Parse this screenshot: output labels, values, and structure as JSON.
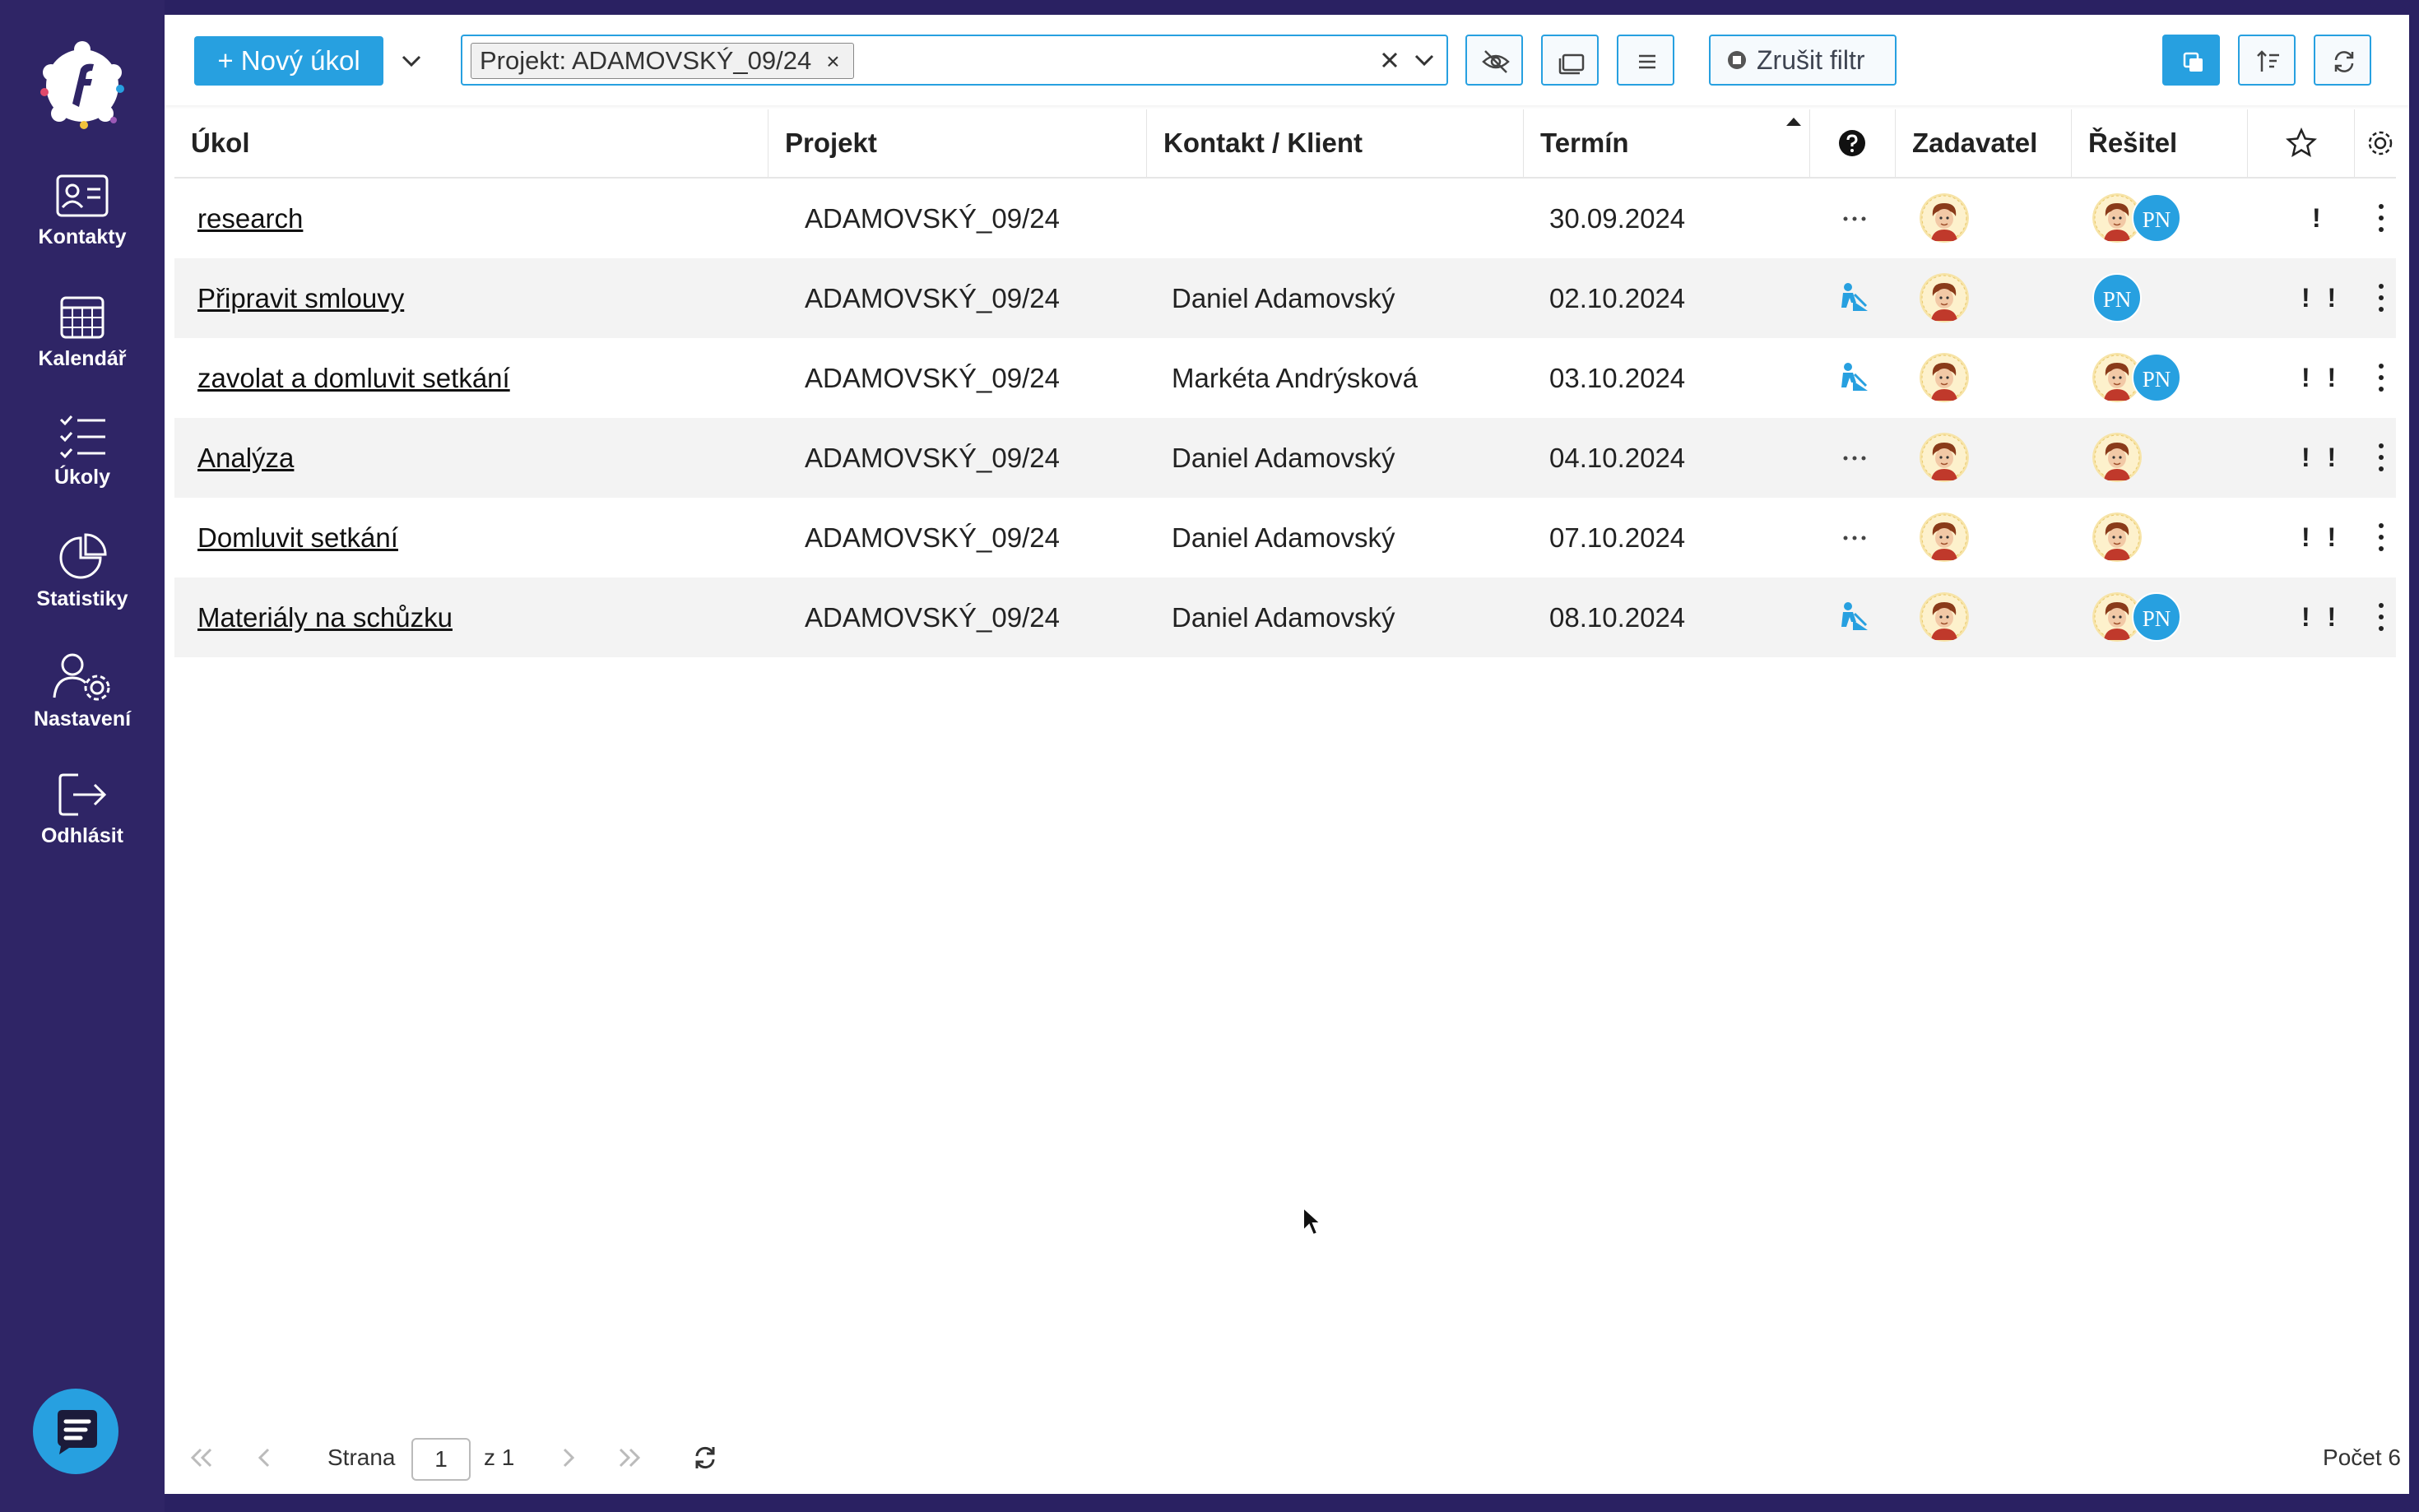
{
  "sidebar": {
    "items": [
      {
        "label": "Kontakty",
        "icon": "contact-card-icon"
      },
      {
        "label": "Kalendář",
        "icon": "calendar-icon"
      },
      {
        "label": "Úkoly",
        "icon": "tasks-list-icon"
      },
      {
        "label": "Statistiky",
        "icon": "pie-chart-icon"
      },
      {
        "label": "Nastavení",
        "icon": "user-settings-icon"
      },
      {
        "label": "Odhlásit",
        "icon": "logout-icon"
      }
    ]
  },
  "toolbar": {
    "new_task_label": "+ Nový úkol",
    "filter_chip": "Projekt: ADAMOVSKÝ_09/24",
    "chip_remove": "×",
    "clear_filter_label": "Zrušit filtr"
  },
  "table": {
    "columns": [
      "Úkol",
      "Projekt",
      "Kontakt / Klient",
      "Termín",
      "Zadavatel",
      "Řešitel"
    ],
    "rows": [
      {
        "task": "research",
        "project": "ADAMOVSKÝ_09/24",
        "contact": "",
        "deadline": "30.09.2024",
        "status": "dots",
        "solvers": [
          "avatar",
          "PN"
        ],
        "priority": "!"
      },
      {
        "task": "Připravit smlouvy",
        "project": "ADAMOVSKÝ_09/24",
        "contact": "Daniel Adamovský",
        "deadline": "02.10.2024",
        "status": "in-progress",
        "solvers": [
          "PN"
        ],
        "priority": "! !"
      },
      {
        "task": "zavolat a domluvit setkání",
        "project": "ADAMOVSKÝ_09/24",
        "contact": "Markéta Andrýsková",
        "deadline": "03.10.2024",
        "status": "in-progress",
        "solvers": [
          "avatar",
          "PN"
        ],
        "priority": "! !"
      },
      {
        "task": "Analýza",
        "project": "ADAMOVSKÝ_09/24",
        "contact": "Daniel Adamovský",
        "deadline": "04.10.2024",
        "status": "dots",
        "solvers": [
          "avatar"
        ],
        "priority": "! !"
      },
      {
        "task": "Domluvit setkání",
        "project": "ADAMOVSKÝ_09/24",
        "contact": "Daniel Adamovský",
        "deadline": "07.10.2024",
        "status": "dots",
        "solvers": [
          "avatar"
        ],
        "priority": "! !"
      },
      {
        "task": "Materiály na schůzku",
        "project": "ADAMOVSKÝ_09/24",
        "contact": "Daniel Adamovský",
        "deadline": "08.10.2024",
        "status": "in-progress",
        "solvers": [
          "avatar",
          "PN"
        ],
        "priority": "! !"
      }
    ]
  },
  "footer": {
    "page_label": "Strana",
    "page_value": "1",
    "page_of": "z 1",
    "count_label": "Počet 6"
  },
  "colors": {
    "sidebar": "#2f2566",
    "accent": "#27a0e0"
  }
}
